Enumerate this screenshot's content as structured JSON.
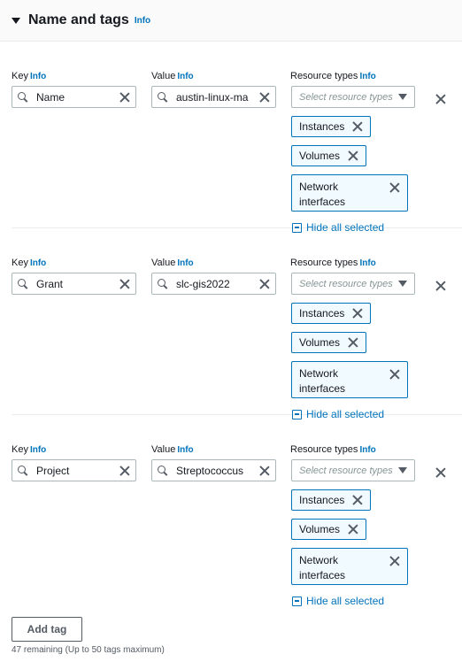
{
  "header": {
    "title": "Name and tags",
    "info": "Info"
  },
  "labels": {
    "key": "Key",
    "value": "Value",
    "resource_types": "Resource types",
    "info": "Info"
  },
  "select_placeholder": "Select resource types",
  "hide_all_selected": "Hide all selected",
  "tags": [
    {
      "key": "Name",
      "value": "austin-linux-ma",
      "resource_types": [
        "Instances",
        "Volumes",
        "Network interfaces"
      ]
    },
    {
      "key": "Grant",
      "value": "slc-gis2022",
      "resource_types": [
        "Instances",
        "Volumes",
        "Network interfaces"
      ]
    },
    {
      "key": "Project",
      "value": "Streptococcus",
      "resource_types": [
        "Instances",
        "Volumes",
        "Network interfaces"
      ]
    }
  ],
  "token_labels": {
    "instances": "Instances",
    "volumes": "Volumes",
    "network_line1": "Network",
    "network_line2": "interfaces"
  },
  "add_tag": "Add tag",
  "remaining": "47 remaining (Up to 50 tags maximum)"
}
